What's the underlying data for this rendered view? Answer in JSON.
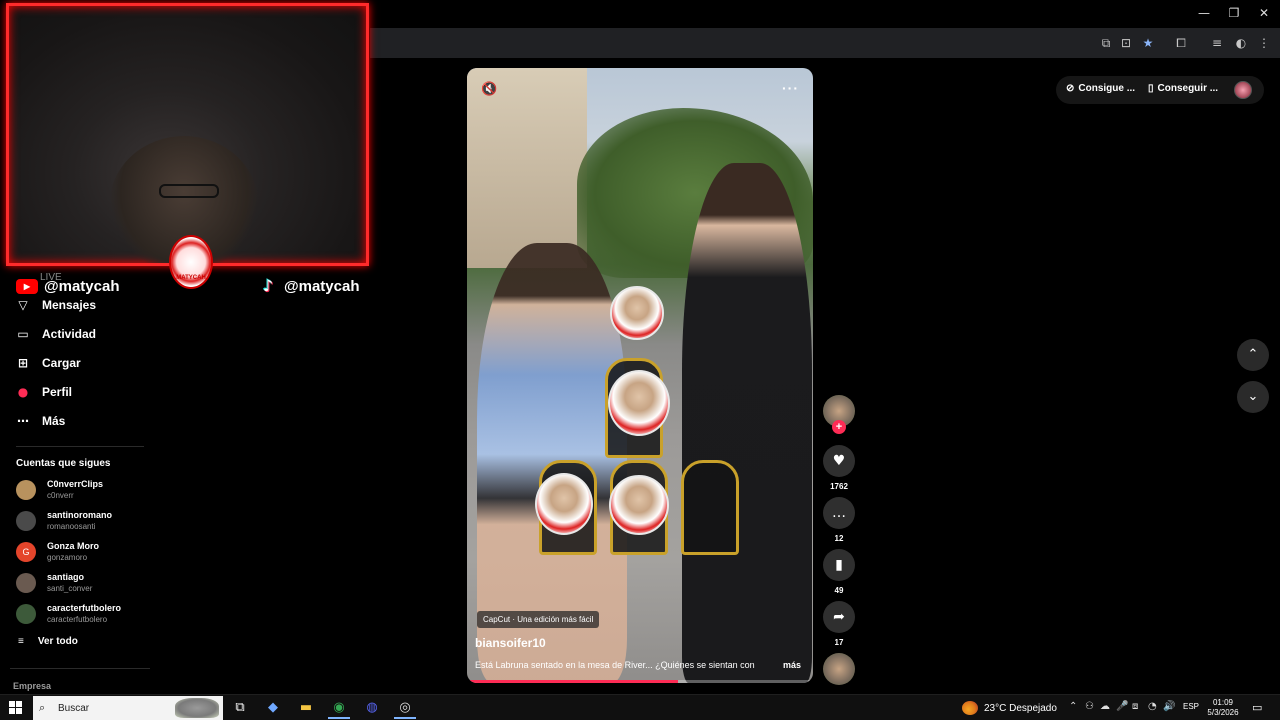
{
  "browser": {
    "window_controls": {
      "minimize": "—",
      "restore": "❐",
      "close": "✕"
    },
    "toolbar_icons": [
      "translate-icon",
      "install-icon",
      "bookmark-star-icon",
      "extensions-icon",
      "media-icon",
      "profile-icon",
      "menu-icon"
    ],
    "toolbar_glyphs": {
      "translate": "⧉",
      "install": "⊡",
      "star": "★",
      "ext": "⧠",
      "media": "≡",
      "profile": "◐",
      "menu": "⋮"
    }
  },
  "overlay": {
    "live_label": "LIVE",
    "youtube_handle": "@matycah",
    "tiktok_handle": "@matycah",
    "youtube_glyph": "▶",
    "tiktok_glyph": "♪",
    "badge_text": "MATYCAH"
  },
  "sidebar": {
    "nav": [
      {
        "label": "Mensajes",
        "glyph": "▽"
      },
      {
        "label": "Actividad",
        "glyph": "▭"
      },
      {
        "label": "Cargar",
        "glyph": "⊞"
      },
      {
        "label": "Perfil",
        "glyph": "●"
      },
      {
        "label": "Más",
        "glyph": "⋯"
      }
    ],
    "following_title": "Cuentas que sigues",
    "following": [
      {
        "name": "C0nverrClips",
        "username": "c0nverr",
        "avatar_color": "#b8925e",
        "initial": ""
      },
      {
        "name": "santinoromano",
        "username": "romanoosanti",
        "avatar_color": "#4a4a4a",
        "initial": ""
      },
      {
        "name": "Gonza Moro",
        "username": "gonzamoro",
        "avatar_color": "#e4452b",
        "initial": "G"
      },
      {
        "name": "santiago",
        "username": "santi_conver",
        "avatar_color": "#6a5a50",
        "initial": ""
      },
      {
        "name": "caracterfutbolero",
        "username": "caracterfutbolero",
        "avatar_color": "#3d5a3a",
        "initial": ""
      }
    ],
    "see_all": "Ver todo",
    "see_all_glyph": "≡",
    "footer": "Empresa"
  },
  "video": {
    "mute_glyph": "🔇",
    "more_glyph": "···",
    "capcut_label": "CapCut · Una edición más fácil",
    "author": "biansoifer10",
    "description": "Está Labruna sentado en la mesa de River... ¿Quiénes se sientan con",
    "more_label": "más",
    "progress": 0.61
  },
  "rail": {
    "follow_plus": "+",
    "like_glyph": "♥",
    "comment_glyph": "…",
    "bookmark_glyph": "▮",
    "share_glyph": "➦",
    "likes": "1762",
    "comments": "12",
    "saves": "49",
    "shares": "17"
  },
  "top_actions": {
    "get_coins": "Consigue ...",
    "get_app": "Conseguir ...",
    "coin_glyph": "⊘",
    "phone_glyph": "▯"
  },
  "nav_arrows": {
    "up": "⌃",
    "down": "⌄"
  },
  "taskbar": {
    "search_placeholder": "Buscar",
    "search_glyph": "⌕",
    "apps": [
      {
        "name": "task-view-icon",
        "glyph": "⧉",
        "color": "#ffffff"
      },
      {
        "name": "copilot-icon",
        "glyph": "◆",
        "color": "#6fa8ff"
      },
      {
        "name": "file-explorer-icon",
        "glyph": "▬",
        "color": "#f4c542"
      },
      {
        "name": "chrome-icon",
        "glyph": "◉",
        "color": "#34a853"
      },
      {
        "name": "discord-icon",
        "glyph": "◍",
        "color": "#5865f2"
      },
      {
        "name": "obs-icon",
        "glyph": "◎",
        "color": "#dddddd"
      }
    ],
    "weather": "23°C  Despejado",
    "tray_glyphs": [
      "⌃",
      "⚇",
      "☁",
      "🎤",
      "⧈",
      "◔",
      "🔊"
    ],
    "language": "ESP",
    "time": "01:09",
    "date": "5/3/2026",
    "notif_glyph": "▭"
  }
}
